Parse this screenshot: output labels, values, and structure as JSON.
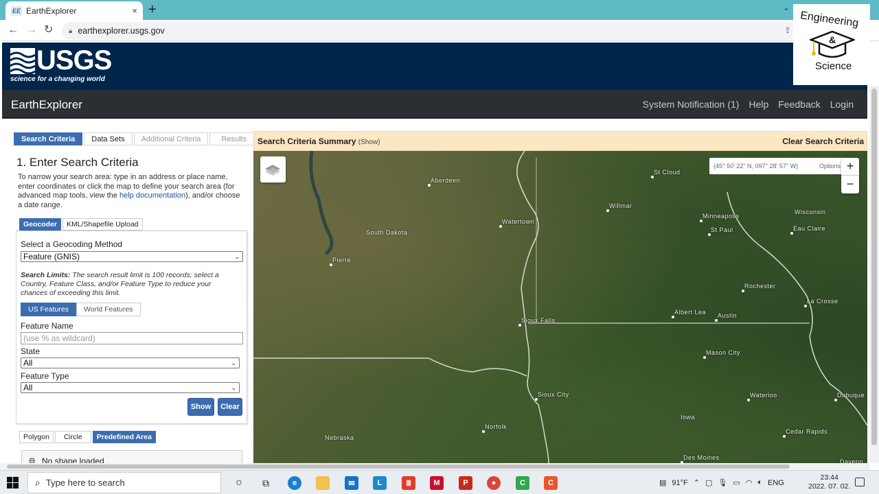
{
  "browser": {
    "tab_title": "EarthExplorer",
    "tab_icon_text": "EE",
    "close_glyph": "×",
    "new_tab_glyph": "+",
    "url": "earthexplorer.usgs.gov",
    "back_glyph": "←",
    "forward_glyph": "→",
    "reload_glyph": "↻"
  },
  "usgs": {
    "wordmark": "USGS",
    "tagline": "science for a changing world"
  },
  "watermark": {
    "line1": "Engineering",
    "amp": "&",
    "line2": "Science"
  },
  "nav": {
    "title": "EarthExplorer",
    "links": [
      "System Notification (1)",
      "Help",
      "Feedback",
      "Login"
    ]
  },
  "left": {
    "tabs": [
      "Search Criteria",
      "Data Sets",
      "Additional Criteria",
      "Results"
    ],
    "heading": "1. Enter Search Criteria",
    "intro_before": "To narrow your search area: type in an address or place name, enter coordinates or click the map to define your search area (for advanced map tools, view the ",
    "intro_link": "help documentation",
    "intro_after": "), and/or choose a date range.",
    "geo_tabs": [
      "Geocoder",
      "KML/Shapefile Upload"
    ],
    "method_label": "Select a Geocoding Method",
    "method_value": "Feature (GNIS)",
    "limits_bold": "Search Limits:",
    "limits_text": " The search result limit is 100 records; select a Country, Feature Class, and/or Feature Type to reduce your chances of exceeding this limit.",
    "feature_tabs": [
      "US Features",
      "World Features"
    ],
    "feature_name_label": "Feature Name",
    "feature_name_placeholder": "(use % as wildcard)",
    "state_label": "State",
    "state_value": "All",
    "type_label": "Feature Type",
    "type_value": "All",
    "show_btn": "Show",
    "clear_btn": "Clear",
    "shape_tabs": [
      "Polygon",
      "Circle",
      "Predefined Area"
    ],
    "shape_status": "No shape loaded"
  },
  "summary": {
    "title": "Search Criteria Summary",
    "show": "(Show)",
    "clear": "Clear Search Criteria"
  },
  "map": {
    "coords": "(45° 50' 22\" N, 097° 28' 57\" W)",
    "options": "Options",
    "zoom_in": "+",
    "zoom_out": "−",
    "cities": [
      {
        "name": "Aberdeen"
      },
      {
        "name": "St Cloud"
      },
      {
        "name": "Willmar"
      },
      {
        "name": "Minneapolis"
      },
      {
        "name": "St Paul"
      },
      {
        "name": "Wisconsin"
      },
      {
        "name": "Eau Claire"
      },
      {
        "name": "Watertown"
      },
      {
        "name": "South Dakota"
      },
      {
        "name": "Pierre"
      },
      {
        "name": "Rochester"
      },
      {
        "name": "La Crosse"
      },
      {
        "name": "Albert Lea"
      },
      {
        "name": "Austin"
      },
      {
        "name": "Sioux Falls"
      },
      {
        "name": "Mason City"
      },
      {
        "name": "Sioux City"
      },
      {
        "name": "Waterloo"
      },
      {
        "name": "Dubuque"
      },
      {
        "name": "Norfolk"
      },
      {
        "name": "Iowa"
      },
      {
        "name": "Nebraska"
      },
      {
        "name": "Cedar Rapids"
      },
      {
        "name": "Des Moines"
      },
      {
        "name": "Davenp"
      }
    ]
  },
  "taskbar": {
    "search_placeholder": "Type here to search",
    "temperature": "91°F",
    "language": "ENG",
    "time": "23:44",
    "date": "2022. 07. 02."
  },
  "colors": {
    "usgs_blue": "#00264c",
    "nav_dark": "#2b2f33",
    "accent_blue": "#3c6db0",
    "summary_bg": "#fbe7c3"
  }
}
